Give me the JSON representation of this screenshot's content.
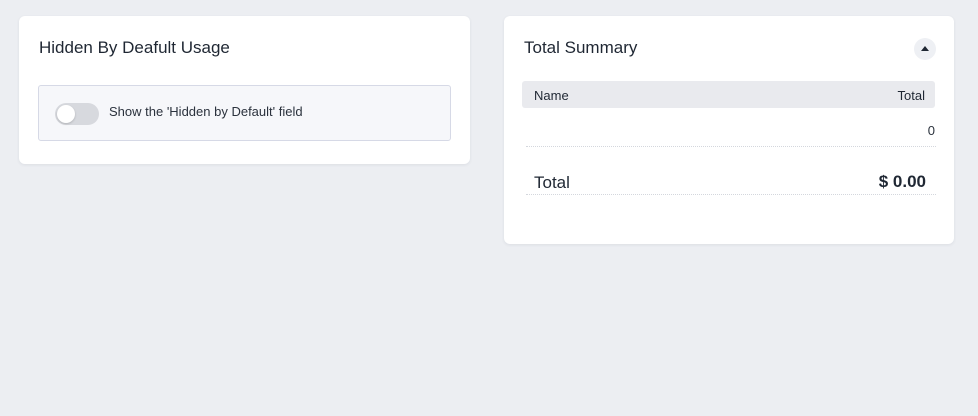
{
  "hidden_card": {
    "title": "Hidden By Deafult Usage",
    "toggle_label": "Show the 'Hidden by Default' field",
    "toggle_on": false
  },
  "summary_card": {
    "title": "Total Summary",
    "collapse_icon": "caret-up-icon",
    "table": {
      "columns": [
        "Name",
        "Total"
      ],
      "rows": [
        {
          "name": "",
          "total": "0"
        }
      ]
    },
    "total_label": "Total",
    "total_value": "$ 0.00"
  }
}
